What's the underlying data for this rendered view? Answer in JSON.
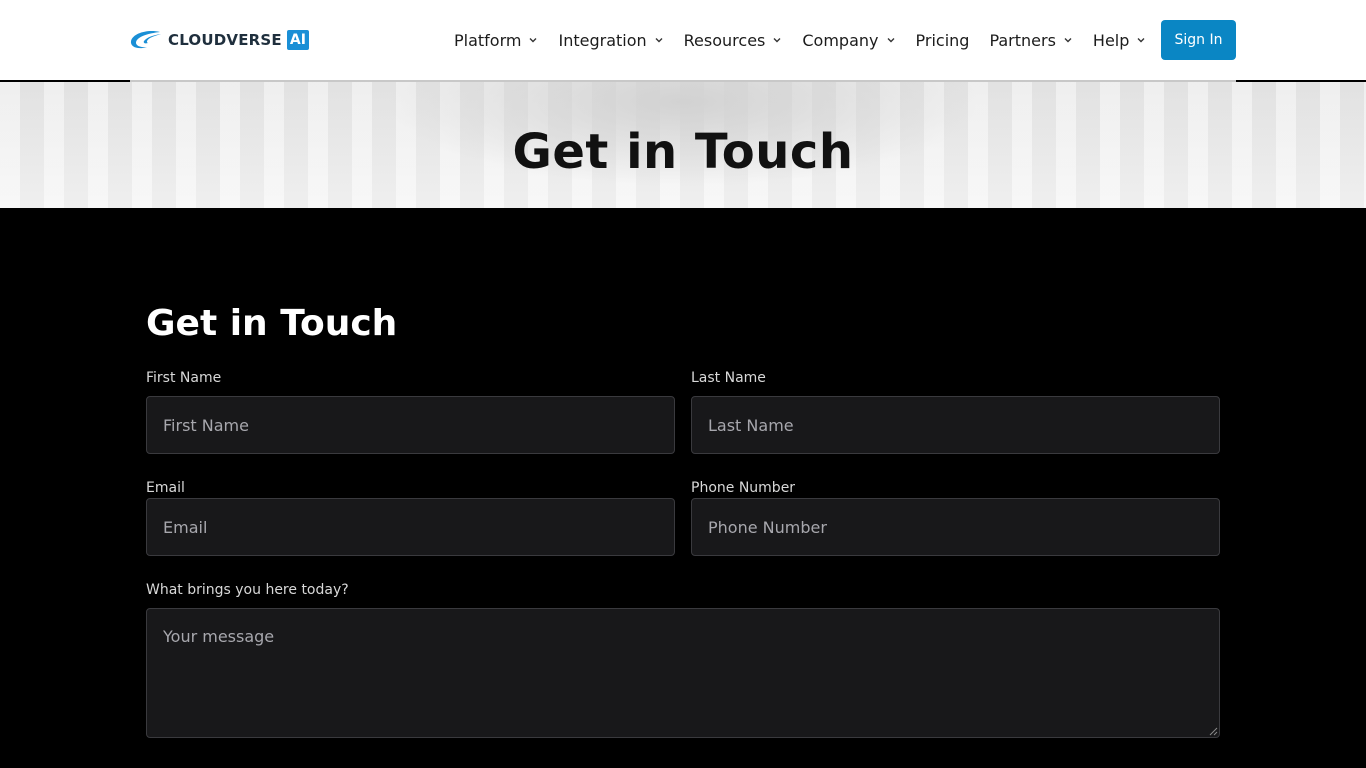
{
  "header": {
    "logo": {
      "word": "CLOUDVERSE",
      "badge": "AI"
    },
    "nav": [
      {
        "label": "Platform",
        "dropdown": true
      },
      {
        "label": "Integration",
        "dropdown": true
      },
      {
        "label": "Resources",
        "dropdown": true
      },
      {
        "label": "Company",
        "dropdown": true
      },
      {
        "label": "Pricing",
        "dropdown": false
      },
      {
        "label": "Partners",
        "dropdown": true
      },
      {
        "label": "Help",
        "dropdown": true
      }
    ],
    "sign_in": "Sign In"
  },
  "hero": {
    "title": "Get in Touch"
  },
  "form": {
    "title": "Get in Touch",
    "first_name": {
      "label": "First Name",
      "placeholder": "First Name",
      "value": ""
    },
    "last_name": {
      "label": "Last Name",
      "placeholder": "Last Name",
      "value": ""
    },
    "email": {
      "label": "Email",
      "placeholder": "Email",
      "value": ""
    },
    "phone": {
      "label": "Phone Number",
      "placeholder": "Phone Number",
      "value": ""
    },
    "message": {
      "label": "What brings you here today?",
      "placeholder": "Your message",
      "value": ""
    }
  },
  "colors": {
    "accent": "#0a86c4",
    "logo_blue": "#1a8fd6",
    "form_bg": "#000000",
    "field_bg": "#18181a"
  },
  "icons": {
    "logo": "cloudverse-swoosh-icon",
    "dropdown": "chevron-down-icon",
    "resize": "resize-grip-icon"
  }
}
